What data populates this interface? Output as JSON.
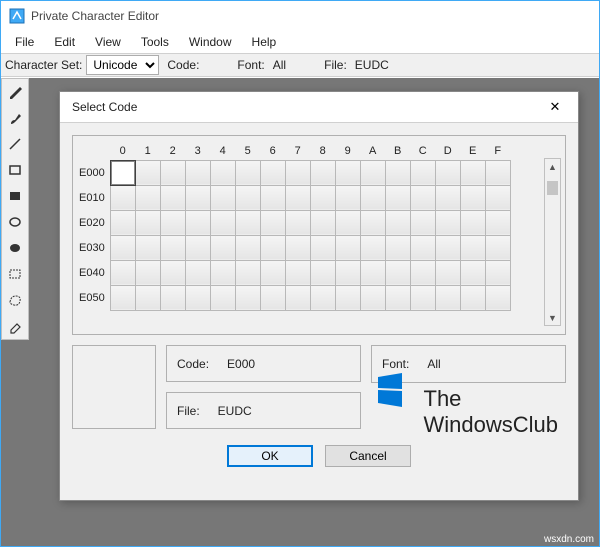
{
  "app": {
    "title": "Private Character Editor"
  },
  "menu": {
    "items": [
      "File",
      "Edit",
      "View",
      "Tools",
      "Window",
      "Help"
    ]
  },
  "infobar": {
    "charset_label": "Character Set:",
    "charset_value": "Unicode",
    "code_label": "Code:",
    "font_label": "Font:",
    "font_value": "All",
    "file_label": "File:",
    "file_value": "EUDC"
  },
  "tools": [
    "pencil",
    "brush",
    "line",
    "rect-outline",
    "rect-fill",
    "ellipse-outline",
    "ellipse-fill",
    "select-rect",
    "select-free",
    "eraser"
  ],
  "dialog": {
    "title": "Select Code",
    "close": "✕",
    "cols": [
      "0",
      "1",
      "2",
      "3",
      "4",
      "5",
      "6",
      "7",
      "8",
      "9",
      "A",
      "B",
      "C",
      "D",
      "E",
      "F"
    ],
    "rows": [
      "E000",
      "E010",
      "E020",
      "E030",
      "E040",
      "E050"
    ],
    "details": {
      "code_k": "Code:",
      "code_v": "E000",
      "font_k": "Font:",
      "font_v": "All",
      "file_k": "File:",
      "file_v": "EUDC"
    },
    "ok": "OK",
    "cancel": "Cancel"
  },
  "watermark": {
    "line1": "The",
    "line2": "WindowsClub"
  },
  "footer_url": "wsxdn.com"
}
